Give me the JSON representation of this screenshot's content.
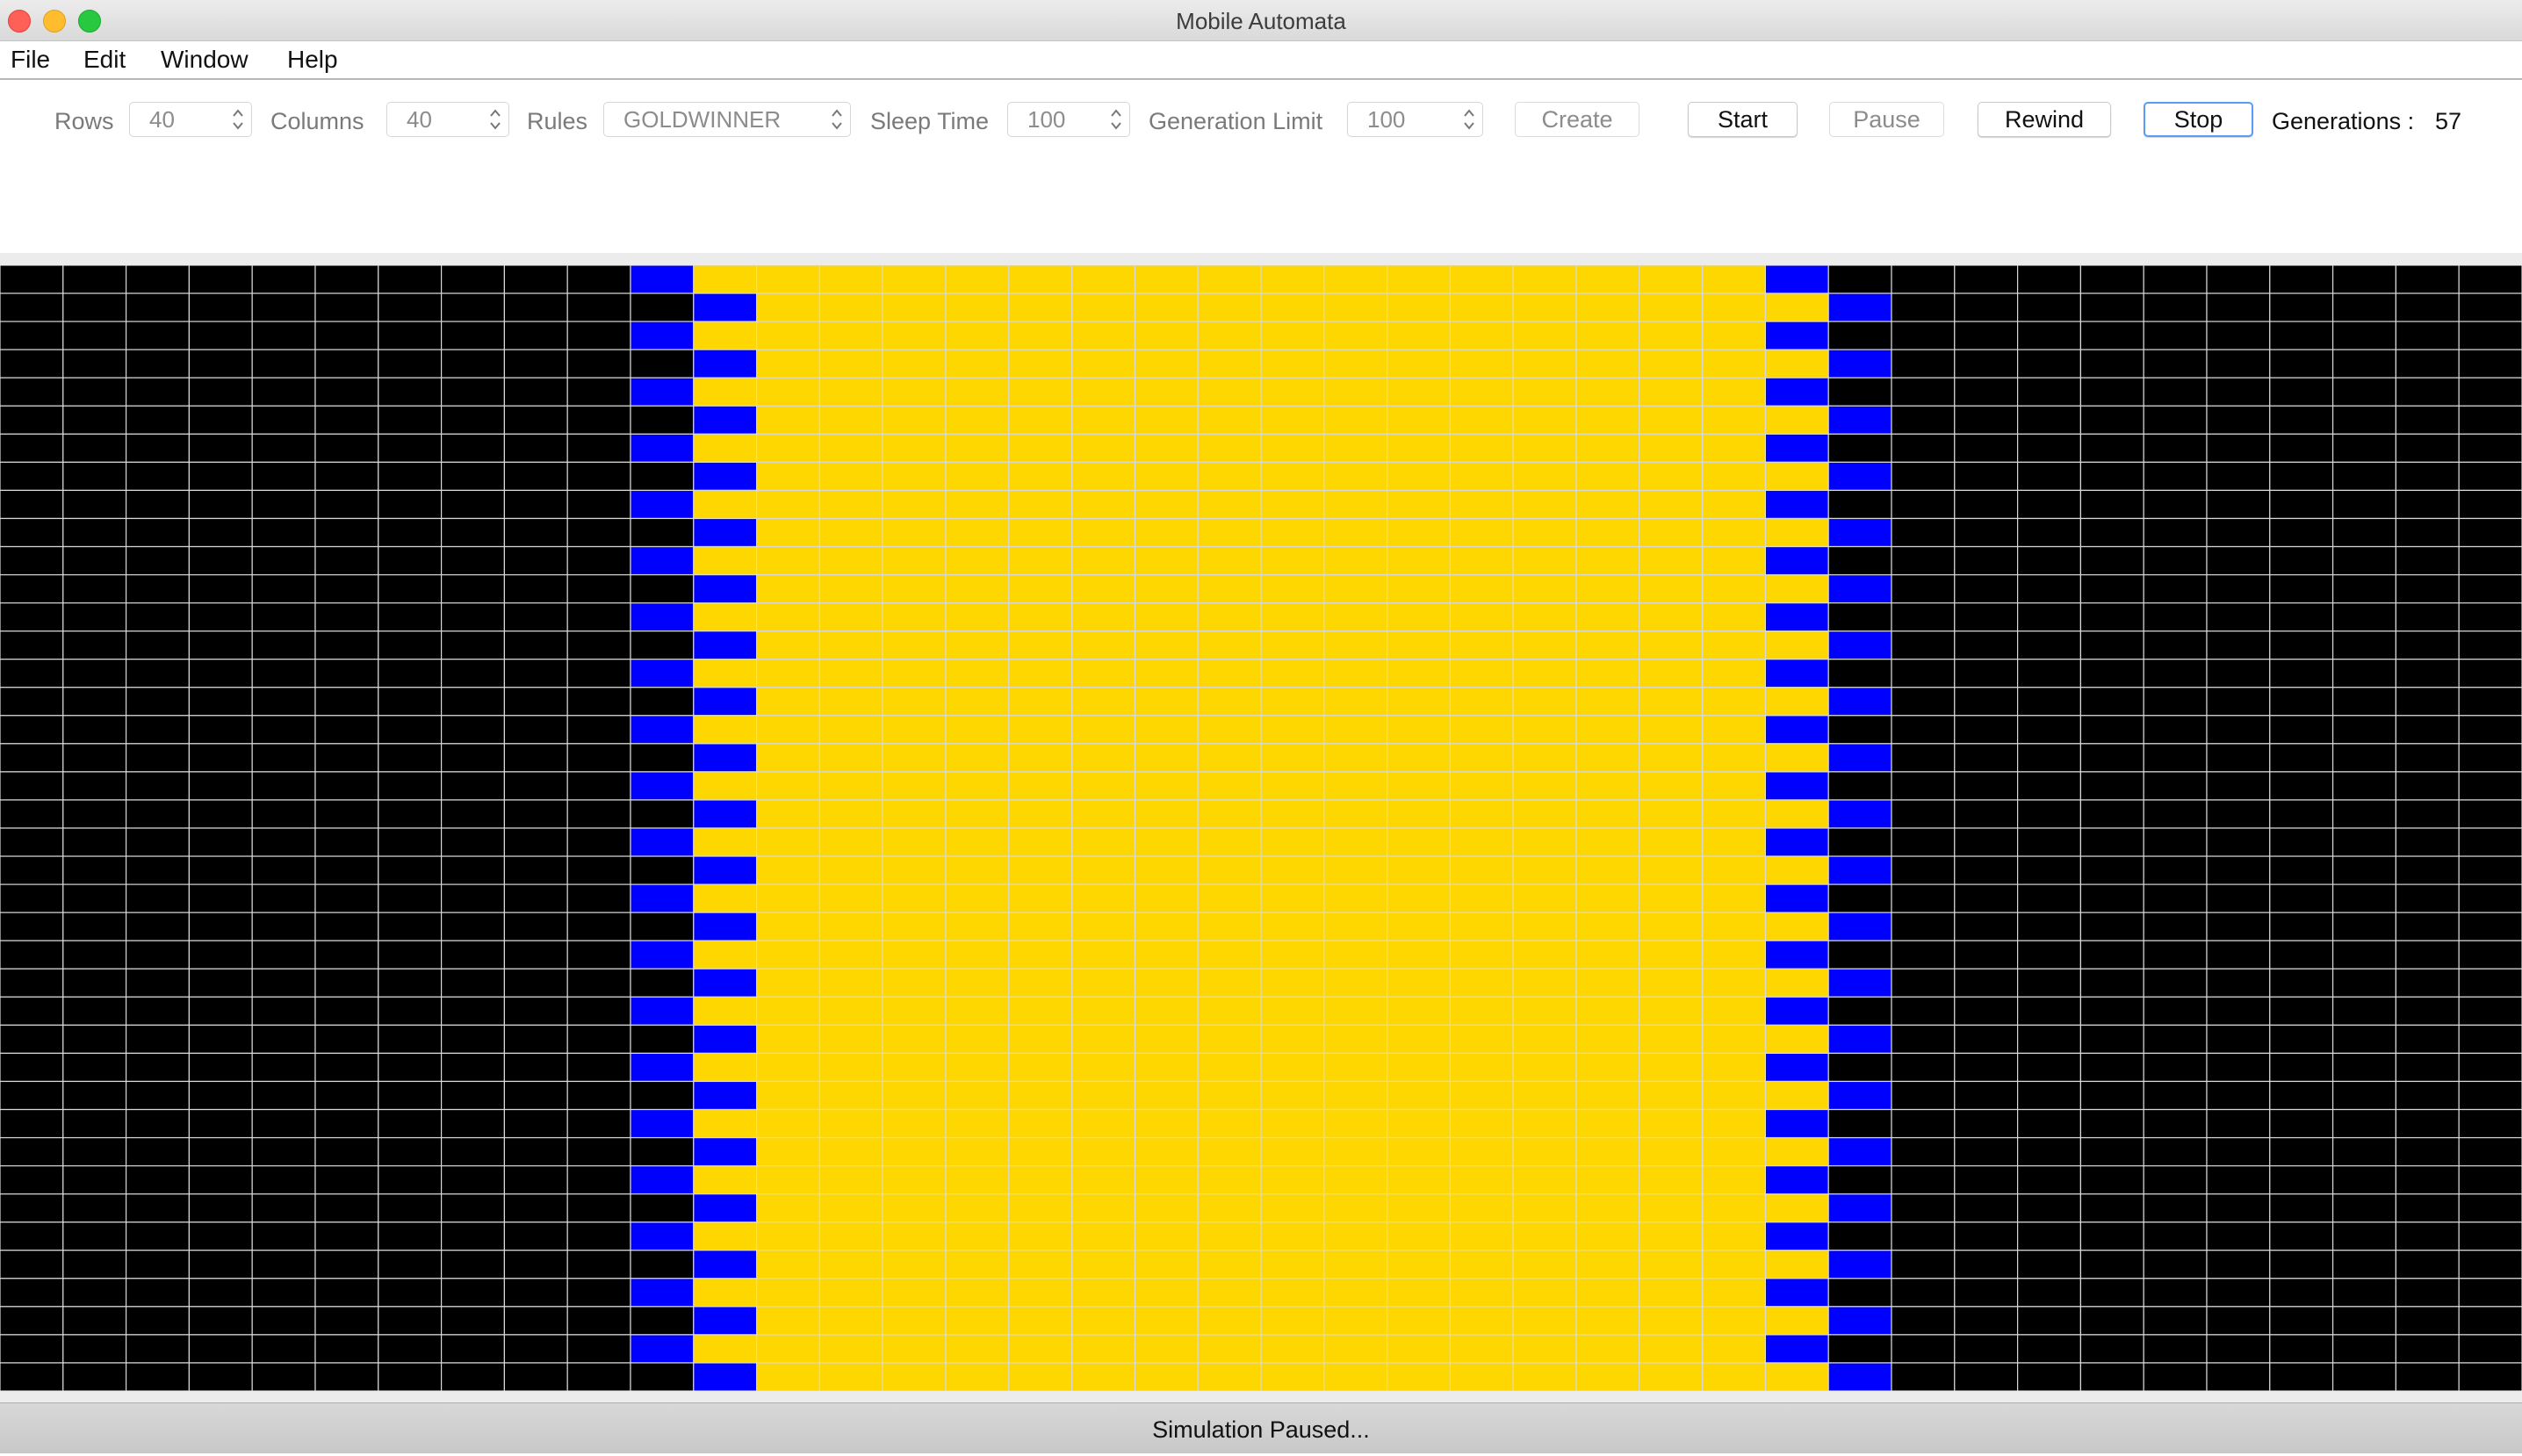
{
  "window": {
    "title": "Mobile Automata"
  },
  "menu": {
    "items": [
      "File",
      "Edit",
      "Window",
      "Help"
    ]
  },
  "toolbar": {
    "rows_label": "Rows",
    "rows_value": "40",
    "columns_label": "Columns",
    "columns_value": "40",
    "rules_label": "Rules",
    "rules_value": "GOLDWINNER",
    "sleep_label": "Sleep Time",
    "sleep_value": "100",
    "limit_label": "Generation Limit",
    "limit_value": "100",
    "create_label": "Create",
    "start_label": "Start",
    "pause_label": "Pause",
    "rewind_label": "Rewind",
    "stop_label": "Stop",
    "generations_label": "Generations :",
    "generations_value": "57"
  },
  "grid": {
    "rows": 40,
    "columns": 40,
    "colors": {
      "dead": "#000000",
      "gold": "#ffd700",
      "blue": "#0000ff",
      "gridline": "#d8d8d8"
    },
    "pattern": {
      "blue_band_left_columns": [
        10,
        11
      ],
      "gold_columns": [
        12,
        27
      ],
      "blue_band_right_columns": [
        28,
        29
      ]
    }
  },
  "status": {
    "text": "Simulation Paused..."
  }
}
